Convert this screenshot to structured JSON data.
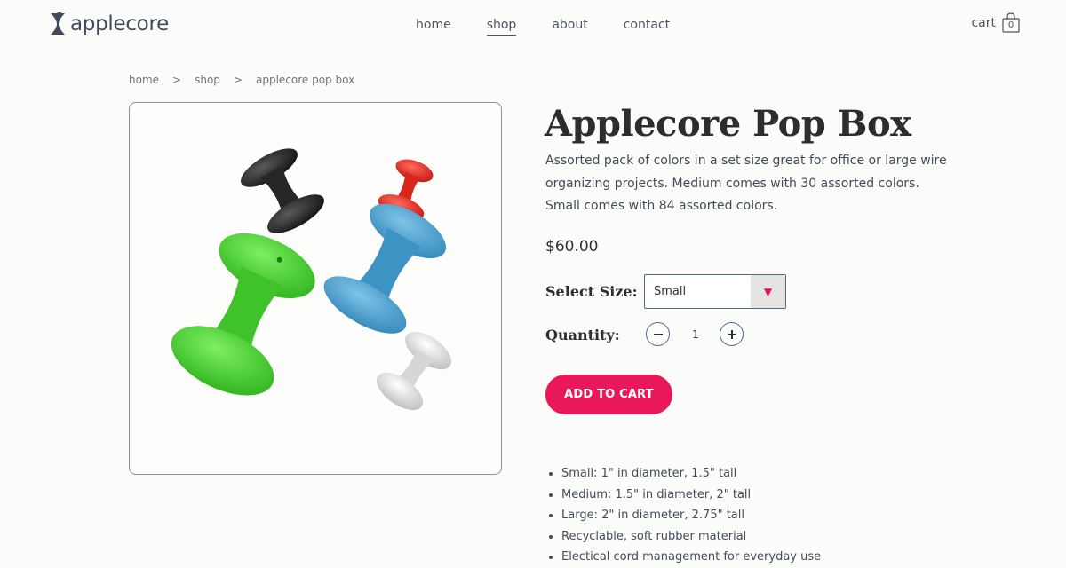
{
  "header": {
    "brand": "applecore",
    "nav": [
      "home",
      "shop",
      "about",
      "contact"
    ],
    "active_nav": "shop",
    "cart_label": "cart",
    "cart_count": "0"
  },
  "breadcrumb": [
    "home",
    ">",
    "shop",
    ">",
    "applecore pop box"
  ],
  "product": {
    "title": "Applecore Pop Box",
    "description": "Assorted pack of colors in a set size great for office or large wire organizing projects. Medium comes with 30 assorted colors. Small comes with 84 assorted colors.",
    "price": "$60.00",
    "size_label": "Select Size:",
    "size_value": "Small",
    "quantity_label": "Quantity:",
    "quantity": "1",
    "add_to_cart": "ADD TO CART",
    "features": [
      "Small: 1\" in diameter, 1.5\" tall",
      "Medium: 1.5\" in diameter, 2\" tall",
      "Large: 2\" in diameter, 2.75\" tall",
      "Recyclable, soft rubber material",
      "Electical cord management for everyday use"
    ]
  },
  "colors": {
    "accent": "#e8185a",
    "border": "#4a6d8c",
    "background": "#fbfbf9"
  }
}
